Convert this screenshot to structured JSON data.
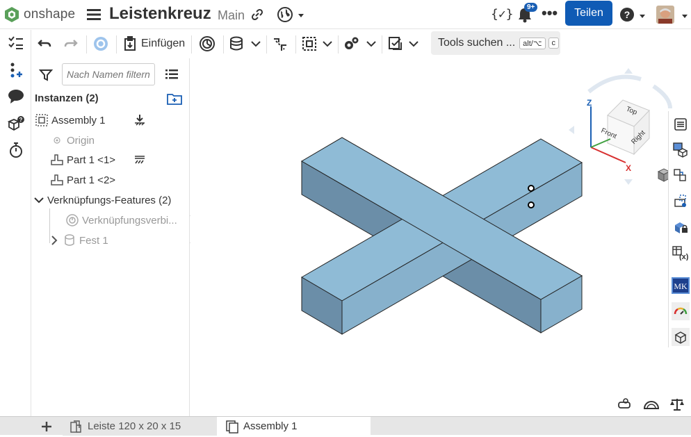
{
  "app": {
    "brand": "onshape",
    "document_title": "Leistenkreuz",
    "branch": "Main",
    "notification_badge": "9+",
    "share_label": "Teilen",
    "accent_color": "#0f5bb5"
  },
  "toolbar": {
    "insert_label": "Einfügen",
    "tools_search_label": "Tools suchen ...",
    "shortcut_key_1": "alt/⌥",
    "shortcut_key_2": "c"
  },
  "feature_panel": {
    "filter_placeholder": "Nach Namen filtern",
    "instances_header": "Instanzen (2)",
    "tree": [
      {
        "label": "Assembly 1"
      },
      {
        "label": "Origin"
      },
      {
        "label": "Part 1 <1>"
      },
      {
        "label": "Part 1 <2>"
      },
      {
        "label": "Verknüpfungs-Features (2)"
      },
      {
        "label": "Verknüpfungsverbi..."
      },
      {
        "label": "Fest 1"
      }
    ]
  },
  "viewcube": {
    "face_top": "Top",
    "face_front": "Front",
    "face_right": "Right",
    "axis_z": "Z",
    "axis_x": "X"
  },
  "tabs": [
    {
      "label": "Leiste 120 x 20 x 15"
    },
    {
      "label": "Assembly 1"
    }
  ]
}
